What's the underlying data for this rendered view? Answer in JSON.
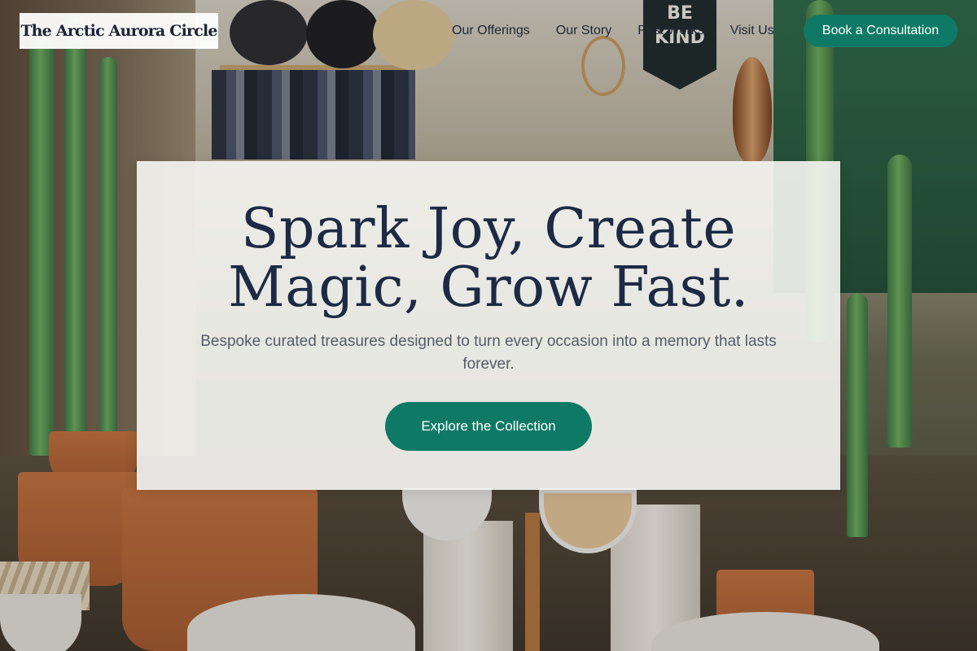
{
  "header": {
    "logo_text": "The Arctic Aurora Circle",
    "nav": [
      {
        "label": "Our Offerings"
      },
      {
        "label": "Our Story"
      },
      {
        "label": "Past Works"
      },
      {
        "label": "Visit Us"
      }
    ],
    "cta_label": "Book a Consultation"
  },
  "hero": {
    "title": "Spark Joy, Create Magic, Grow Fast.",
    "subtitle": "Bespoke curated treasures designed to turn every occasion into a memory that lasts forever.",
    "cta_label": "Explore the Collection"
  },
  "background": {
    "banner_text": "BE KIND"
  },
  "colors": {
    "accent": "#0e7a66",
    "heading": "#1c2a45",
    "body_text": "#555c66",
    "card_bg": "#f6f6f3"
  }
}
